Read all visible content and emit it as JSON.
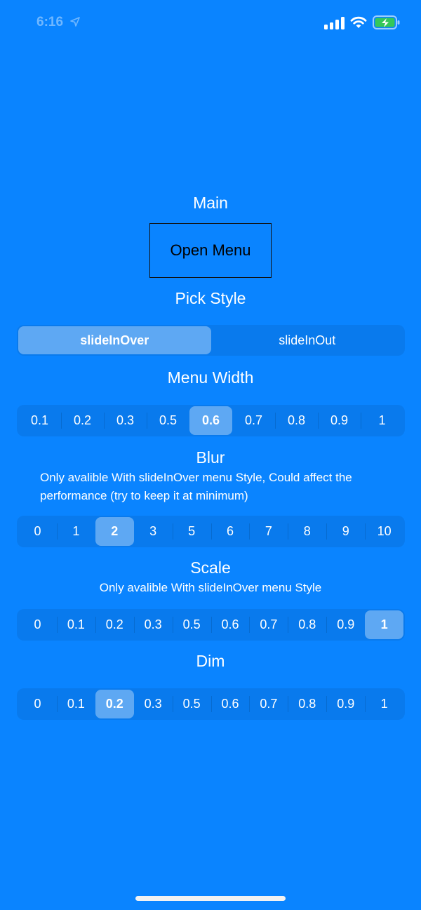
{
  "status_bar": {
    "time": "6:16"
  },
  "main": {
    "title": "Main",
    "open_menu_label": "Open Menu"
  },
  "pick_style": {
    "title": "Pick Style",
    "options": [
      "slideInOver",
      "slideInOut"
    ],
    "selected": "slideInOver"
  },
  "menu_width": {
    "title": "Menu Width",
    "options": [
      "0.1",
      "0.2",
      "0.3",
      "0.5",
      "0.6",
      "0.7",
      "0.8",
      "0.9",
      "1"
    ],
    "selected": "0.6"
  },
  "blur": {
    "title": "Blur",
    "description_line1": "Only avalible With slideInOver menu Style, Could affect the",
    "description_line2": "performance (try to keep it at minimum)",
    "options": [
      "0",
      "1",
      "2",
      "3",
      "5",
      "6",
      "7",
      "8",
      "9",
      "10"
    ],
    "selected": "2"
  },
  "scale": {
    "title": "Scale",
    "description": "Only avalible With slideInOver menu Style",
    "options": [
      "0",
      "0.1",
      "0.2",
      "0.3",
      "0.5",
      "0.6",
      "0.7",
      "0.8",
      "0.9",
      "1"
    ],
    "selected": "1"
  },
  "dim": {
    "title": "Dim",
    "options": [
      "0",
      "0.1",
      "0.2",
      "0.3",
      "0.5",
      "0.6",
      "0.7",
      "0.8",
      "0.9",
      "1"
    ],
    "selected": "0.2"
  },
  "colors": {
    "background": "#0A84FF",
    "segment_selected": "rgba(255,255,255,0.35)",
    "battery_fill": "#34C759"
  },
  "icons": [
    "location-arrow-icon",
    "cellular-signal-icon",
    "wifi-icon",
    "battery-charging-icon"
  ]
}
